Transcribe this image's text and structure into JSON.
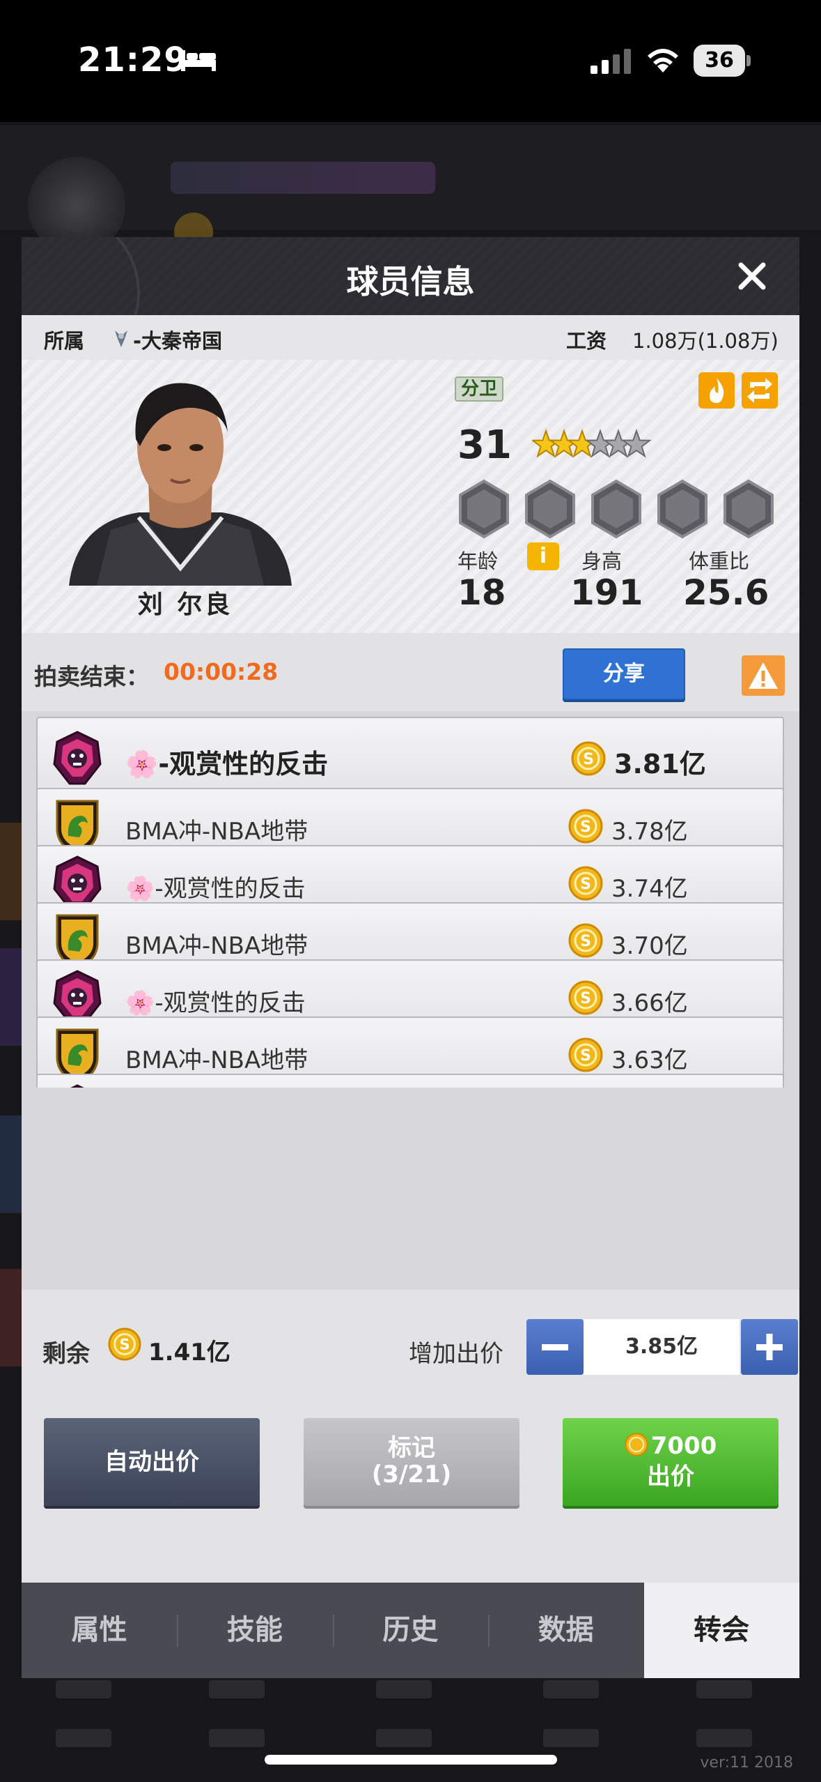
{
  "status_bar": {
    "time": "21:29",
    "battery": "36"
  },
  "modal": {
    "title": "球员信息",
    "affiliation_label": "所属",
    "team": "-大秦帝国",
    "salary_label": "工资",
    "salary": "1.08万(1.08万)"
  },
  "player": {
    "name": "刘 尔良",
    "position": "分卫",
    "overall": "31",
    "star_rating": 3,
    "star_max": 6,
    "age_label": "年龄",
    "age": "18",
    "height_label": "身高",
    "height": "191",
    "ratio_label": "体重比",
    "ratio": "25.6",
    "info_icon": "i"
  },
  "auction": {
    "end_label": "拍卖结束：",
    "timer": "00:00:28",
    "share_label": "分享"
  },
  "bids": [
    {
      "team": "🌸-观赏性的反击",
      "amount": "3.81亿",
      "crest": "pink-bear-crest"
    },
    {
      "team": "BMA冲-NBA地带",
      "amount": "3.78亿",
      "crest": "gold-dragon-shield"
    },
    {
      "team": "🌸-观赏性的反击",
      "amount": "3.74亿",
      "crest": "pink-bear-crest"
    },
    {
      "team": "BMA冲-NBA地带",
      "amount": "3.70亿",
      "crest": "gold-dragon-shield"
    },
    {
      "team": "🌸-观赏性的反击",
      "amount": "3.66亿",
      "crest": "pink-bear-crest"
    },
    {
      "team": "BMA冲-NBA地带",
      "amount": "3.63亿",
      "crest": "gold-dragon-shield"
    }
  ],
  "bottom": {
    "remain_label": "剩余",
    "remain": "1.41亿",
    "raise_label": "增加出价",
    "bid_value": "3.85亿",
    "auto_bid": "自动出价",
    "mark_label": "标记",
    "mark_count": "(3/21)",
    "offer_cost": "7000",
    "offer_label": "出价"
  },
  "tabs": [
    "属性",
    "技能",
    "历史",
    "数据",
    "转会"
  ],
  "active_tab": 4,
  "version": "ver:11  2018",
  "colors": {
    "timer": "#f26a1b",
    "share": "#2f72d3",
    "offer": "#4cb42e",
    "accent": "#f5a200"
  }
}
